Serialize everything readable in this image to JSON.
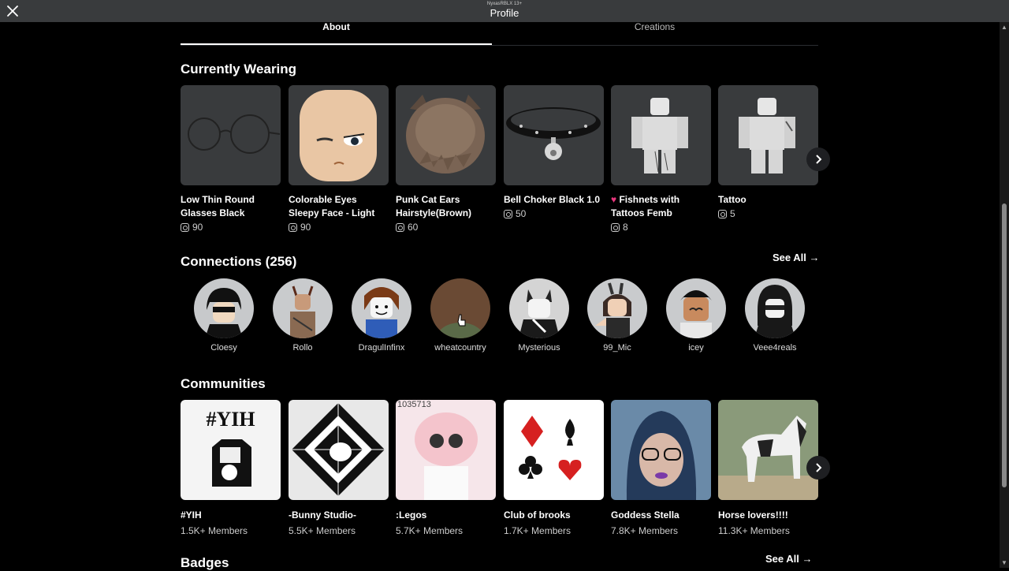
{
  "topbar": {
    "subtitle": "NyxasRBLX 13+",
    "title": "Profile"
  },
  "tabs": [
    {
      "label": "About"
    },
    {
      "label": "Creations"
    }
  ],
  "currently_wearing": {
    "title": "Currently Wearing",
    "items": [
      {
        "name": "Low Thin Round Glasses Black",
        "price": "90"
      },
      {
        "name": "Colorable Eyes Sleepy Face - Light",
        "price": "90"
      },
      {
        "name": "Punk Cat Ears Hairstyle(Brown)",
        "price": "60"
      },
      {
        "name": "Bell Choker Black 1.0",
        "price": "50"
      },
      {
        "name": "Fishnets with Tattoos Femb",
        "price": "8"
      },
      {
        "name": "Tattoo",
        "price": "5"
      }
    ]
  },
  "connections": {
    "title": "Connections (256)",
    "see_all": "See All",
    "friends": [
      {
        "name": "Cloesy"
      },
      {
        "name": "Rollo"
      },
      {
        "name": "DragulInfinx"
      },
      {
        "name": "wheatcountry"
      },
      {
        "name": "Mysterious"
      },
      {
        "name": "99_Mic"
      },
      {
        "name": "icey"
      },
      {
        "name": "Veee4reals"
      }
    ]
  },
  "communities": {
    "title": "Communities",
    "groups": [
      {
        "name": "#YIH",
        "members": "1.5K+ Members",
        "thumb_text": "#YIH"
      },
      {
        "name": "-Bunny Studio-",
        "members": "5.5K+ Members"
      },
      {
        "name": ":Legos",
        "members": "5.7K+ Members",
        "thumb_text": "1035713"
      },
      {
        "name": "Club of brooks",
        "members": "1.7K+ Members"
      },
      {
        "name": "Goddess Stella",
        "members": "7.8K+ Members"
      },
      {
        "name": "Horse lovers!!!!",
        "members": "11.3K+ Members"
      }
    ]
  },
  "badges": {
    "title": "Badges",
    "see_all": "See All"
  }
}
